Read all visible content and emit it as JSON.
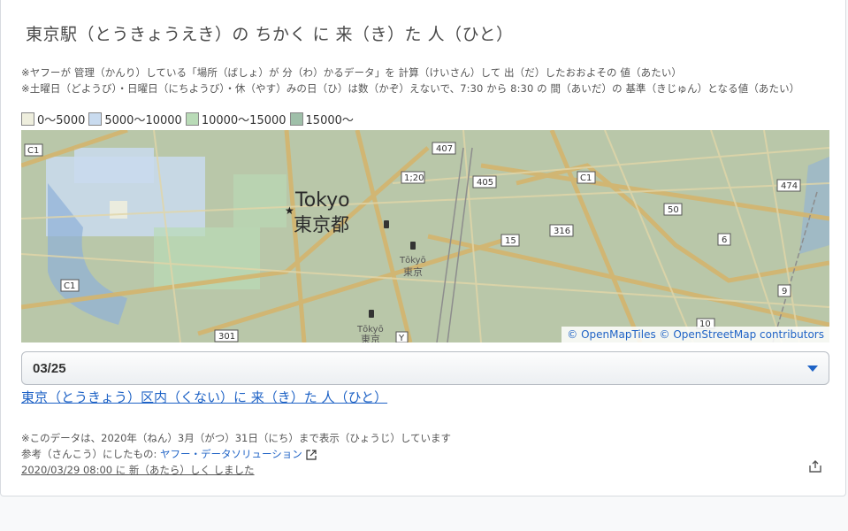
{
  "title": "東京駅（とうきょうえき）の ちかく に 来（き）た 人（ひと）",
  "notes": [
    "※ヤフーが 管理（かんり）している「場所（ばしょ）が 分（わ）かるデータ」を 計算（けいさん）して 出（だ）したおおよその 値（あたい）",
    "※土曜日（どようび）・日曜日（にちようび）・休（やす）みの日（ひ）は数（かぞ）えないで、7:30 から 8:30 の 間（あいだ）の 基準（きじゅん）となる値（あたい）"
  ],
  "legend": [
    {
      "label": "0〜5000",
      "color": "#eeeedd"
    },
    {
      "label": "5000〜10000",
      "color": "#c9dbef"
    },
    {
      "label": "10000〜15000",
      "color": "#b9dbb7"
    },
    {
      "label": "15000〜",
      "color": "#9fbfa9"
    }
  ],
  "map": {
    "city_en": "Tokyo",
    "city_jp": "東京都",
    "station_label_romaji": "Tōkyō",
    "station_label_jp": "東京",
    "station2_label_romaji": "Tōkyō",
    "station2_label_jp": "東京",
    "routes": [
      "C1",
      "407",
      "1;20",
      "405",
      "C1",
      "474",
      "50",
      "316",
      "15",
      "6",
      "C1",
      "9",
      "301",
      "Y",
      "10"
    ],
    "attribution_tiles": "© OpenMapTiles",
    "attribution_osm": "© OpenStreetMap contributors"
  },
  "select": {
    "value": "03/25"
  },
  "main_link": "東京（とうきょう）区内（くない）に 来（き）た 人（ひと）",
  "footer": {
    "data_note": "※このデータは、2020年（ねん）3月（がつ）31日（にち）まで表示（ひょうじ）しています",
    "ref_prefix": "参考（さんこう）にしたもの: ",
    "ref_link": "ヤフー・データソリューション",
    "updated": "2020/03/29 08:00 に 新（あたら）しく しました"
  }
}
